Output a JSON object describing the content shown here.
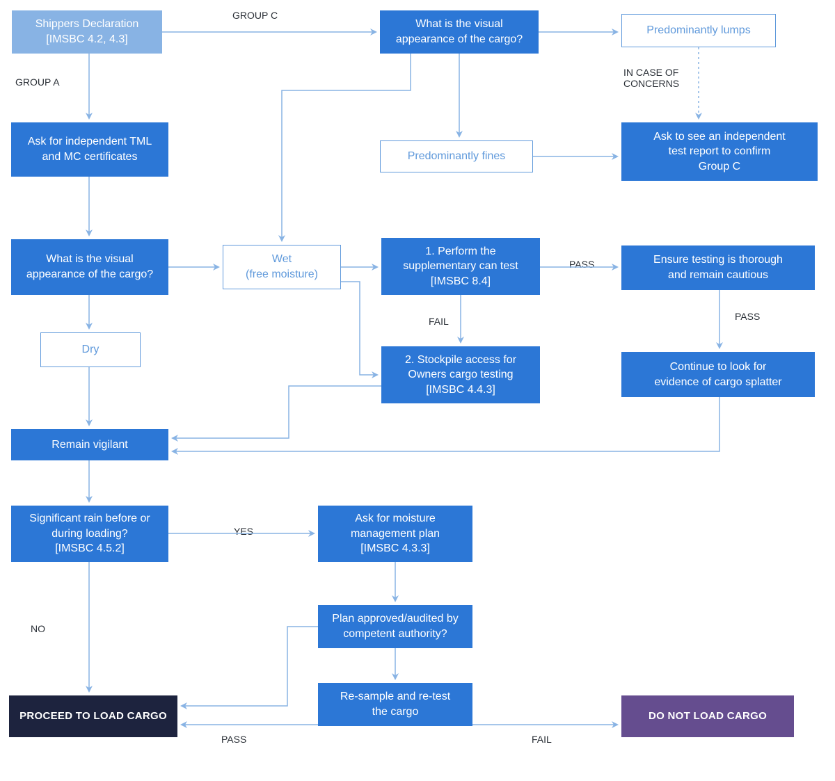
{
  "nodes": {
    "shippers": "Shippers Declaration\n[IMSBC 4.2, 4.3]",
    "visualC": "What is the visual\nappearance of the cargo?",
    "lumps": "Predominantly lumps",
    "fines": "Predominantly fines",
    "indepReport": "Ask to see an independent\ntest report to confirm\nGroup C",
    "tmlMc": "Ask for independent TML\nand MC certificates",
    "visualA": "What is the visual\nappearance of the cargo?",
    "wet": "Wet\n(free moisture)",
    "dry": "Dry",
    "canTest": "1. Perform the\nsupplementary can test\n[IMSBC 8.4]",
    "thorough": "Ensure testing is thorough\nand remain cautious",
    "stockpile": "2. Stockpile access for\nOwners cargo testing\n[IMSBC 4.4.3]",
    "splatter": "Continue to look for\nevidence of cargo splatter",
    "vigilant": "Remain vigilant",
    "rain": "Significant rain before or\nduring loading?\n[IMSBC 4.5.2]",
    "moisture": "Ask for moisture\nmanagement plan\n[IMSBC 4.3.3]",
    "approved": "Plan approved/audited by\ncompetent authority?",
    "resample": "Re-sample and re-test\nthe cargo",
    "proceed": "PROCEED TO LOAD CARGO",
    "doNotLoad": "DO NOT LOAD CARGO"
  },
  "labels": {
    "groupC": "GROUP C",
    "groupA": "GROUP A",
    "concerns": "IN CASE OF\nCONCERNS",
    "pass1": "PASS",
    "pass2": "PASS",
    "fail1": "FAIL",
    "yes": "YES",
    "no": "NO",
    "pass3": "PASS",
    "fail3": "FAIL"
  },
  "colors": {
    "blue": "#2c77d6",
    "lightblue": "#88b3e4",
    "outline": "#5f99db",
    "navy": "#1d233e",
    "purple": "#654d8f",
    "arrow": "#88b3e4",
    "text": "#2a2f36"
  }
}
